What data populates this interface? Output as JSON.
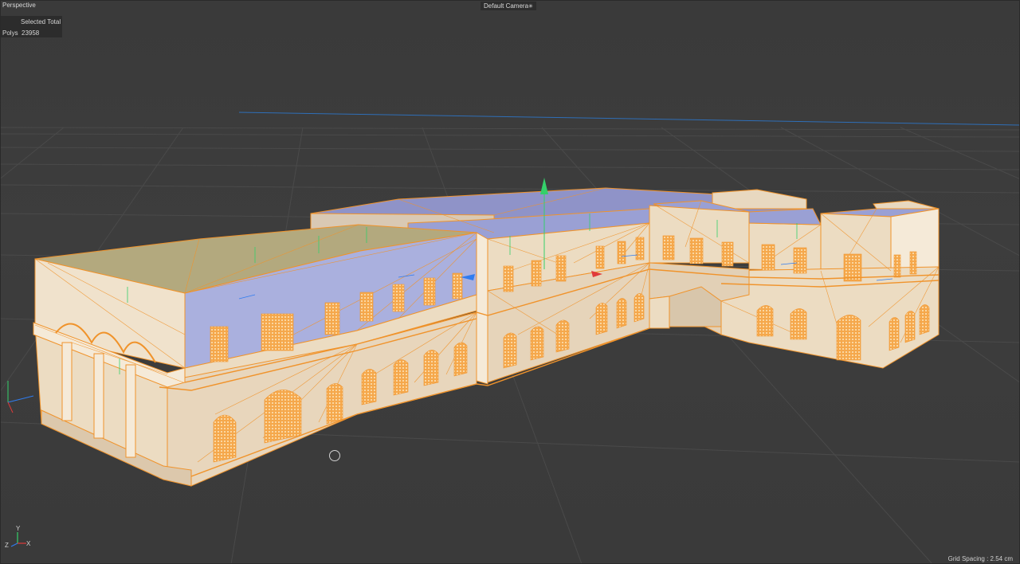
{
  "viewport": {
    "view_name": "Perspective",
    "camera_name": "Default Camera",
    "camera_icon": "camera-link-icon",
    "grid_spacing": "Grid Spacing : 2.54 cm"
  },
  "hud": {
    "header": "Selected Total",
    "rows": [
      {
        "label": "Polys",
        "value": "23958"
      }
    ]
  },
  "axis_gizmo": {
    "labels": [
      "Y",
      "Z",
      "X"
    ]
  },
  "colors": {
    "background": "#3b3b3b",
    "grid_line": "#4a4a4a",
    "selection_orange": "#f0932b",
    "wall_cream": "#ecdcc2",
    "roof_lavender": "#9aa0d4",
    "axis_x": "#e03a3a",
    "axis_y": "#34d06a",
    "axis_z": "#2f7cf0"
  }
}
